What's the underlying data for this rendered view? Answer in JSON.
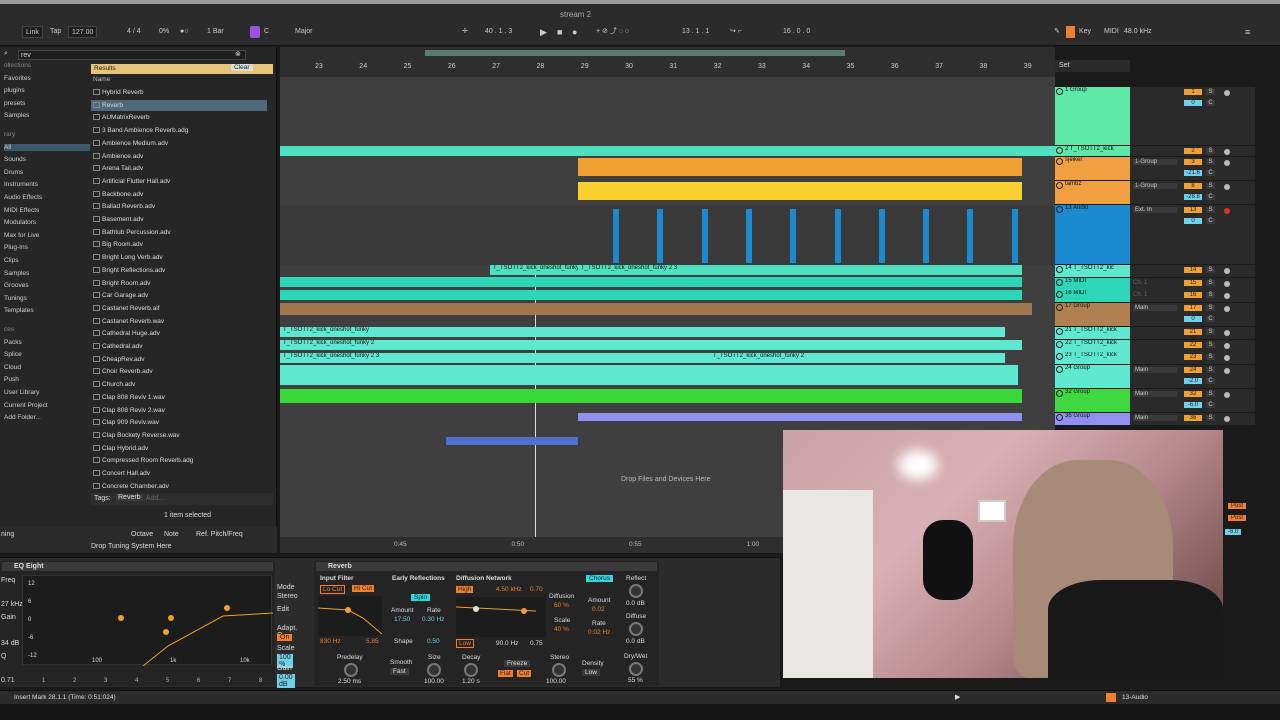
{
  "window_title": "stream 2",
  "transport": {
    "link": "Link",
    "tap": "Tap",
    "tempo": "127.00",
    "signature": "4 / 4",
    "cpu": "0%",
    "quantize": "1 Bar",
    "key_root": "C",
    "key_scale": "Major",
    "position": "40 . 1 . 3",
    "loop_start": "13 . 1 . 1",
    "loop_len": "16 . 0 . 0",
    "key_label": "Key",
    "midi_label": "MIDI",
    "sample_rate": "48.0 kHz"
  },
  "browser": {
    "search": "rev",
    "categories": [
      {
        "label": "ollections",
        "header": true
      },
      {
        "label": "Favorites"
      },
      {
        "label": "plugins"
      },
      {
        "label": "presets"
      },
      {
        "label": "Samples"
      },
      {
        "label": "rary",
        "header": true
      },
      {
        "label": "All"
      },
      {
        "label": "Sounds"
      },
      {
        "label": "Drums"
      },
      {
        "label": "Instruments"
      },
      {
        "label": "Audio Effects"
      },
      {
        "label": "MIDI Effects"
      },
      {
        "label": "Modulators"
      },
      {
        "label": "Max for Live"
      },
      {
        "label": "Plug-Ins"
      },
      {
        "label": "Clips"
      },
      {
        "label": "Samples"
      },
      {
        "label": "Grooves"
      },
      {
        "label": "Tunings"
      },
      {
        "label": "Templates"
      },
      {
        "label": "ces",
        "header": true
      },
      {
        "label": "Packs"
      },
      {
        "label": "Splice"
      },
      {
        "label": "Cloud"
      },
      {
        "label": "Push"
      },
      {
        "label": "User Library"
      },
      {
        "label": "Current Project"
      },
      {
        "label": "Add Folder..."
      }
    ],
    "results_label": "Results",
    "clear_label": "Clear",
    "name_header": "Name",
    "results": [
      "Hybrid Reverb",
      "Reverb",
      "AUMatrixReverb",
      "3 Band Ambience Reverb.adg",
      "Ambience Medium.adv",
      "Ambience.adv",
      "Arena Tail.adv",
      "Artificial Flutter Hall.adv",
      "Backbone.adv",
      "Ballad Reverb.adv",
      "Basement.adv",
      "Bathtub Percussion.adv",
      "Big Room.adv",
      "Bright Long Verb.adv",
      "Bright Reflections.adv",
      "Bright Room.adv",
      "Car Garage.adv",
      "Castanet Reverb.aif",
      "Castanet Reverb.wav",
      "Cathedral Huge.adv",
      "Cathedral.adv",
      "CheapRev.adv",
      "Choir Reverb.adv",
      "Church.adv",
      "Clap 808 Reviv 1.wav",
      "Clap 808 Reviv 2.wav",
      "Clap 909 Reviv.wav",
      "Clap Bockety Reverse.wav",
      "Clap Hybrid.adv",
      "Compressed Room Reverb.adg",
      "Concert Hall.adv",
      "Concrete Chamber.adv"
    ],
    "tags_label": "Tags:",
    "tag": "Reverb",
    "add_label": "Add...",
    "selected": "1 item selected",
    "tuning_octave": "Octave",
    "tuning_note": "Note",
    "tuning_ref": "Ref. Pitch/Freq",
    "tuning_label": "ning",
    "drop_tuning": "Drop Tuning System Here"
  },
  "ruler": [
    "23",
    "24",
    "25",
    "26",
    "27",
    "28",
    "29",
    "30",
    "31",
    "32",
    "33",
    "34",
    "35",
    "36",
    "37",
    "38",
    "39"
  ],
  "time_ruler": [
    "0:45",
    "0:50",
    "0:55",
    "1:00"
  ],
  "clips": {
    "c1": "T_TSOTT2_kick_oneshot_funky",
    "c2": "T_TSOTT2_kick_oneshot_funky 2 3",
    "c3": "T_TSOTT2_kick_oneshot_funky",
    "c4": "T_TSOTT2_kick_oneshot_funky 2",
    "c5": "T_TSOTT2_kick_oneshot_funky 2 3",
    "c6": "T_TSOTT2_kick_oneshot_funky 2"
  },
  "drop_files": "Drop Files and Devices Here",
  "set_label": "Set",
  "tracks": [
    {
      "name": "1 Group",
      "color": "#5ee8a8",
      "num": "1",
      "vol": "0"
    },
    {
      "name": "2 T_TSOTT2_kick",
      "color": "#5ee8a8",
      "num": "2",
      "vol": ""
    },
    {
      "name": "sjeiker",
      "color": "#f0a040",
      "num": "3",
      "vol": "-21.6",
      "route": "1-Group"
    },
    {
      "name": "tambz",
      "color": "#f0a040",
      "num": "8",
      "vol": "-28.8",
      "route": "1-Group"
    },
    {
      "name": "13 Audio",
      "color": "#1c8ad0",
      "num": "13",
      "vol": "0",
      "route": "Ext. In"
    },
    {
      "name": "14 T_TSOTT2_kic",
      "color": "#5ee8d0",
      "num": "14",
      "vol": ""
    },
    {
      "name": "15 MIDI",
      "color": "#2ed6b8",
      "num": "15",
      "vol": "Ch. 1"
    },
    {
      "name": "16 MIDI",
      "color": "#2ed6b8",
      "num": "16",
      "vol": "Ch. 1"
    },
    {
      "name": "17 Group",
      "color": "#b08050",
      "num": "17",
      "vol": "0",
      "route": "Main"
    },
    {
      "name": "21 T_TSOTT2_kick",
      "color": "#5ee8d0",
      "num": "21",
      "vol": ""
    },
    {
      "name": "22 T_TSOTT2_kick",
      "color": "#5ee8d0",
      "num": "22",
      "vol": ""
    },
    {
      "name": "23 T_TSOTT2_kick",
      "color": "#5ee8d0",
      "num": "23",
      "vol": ""
    },
    {
      "name": "24 Group",
      "color": "#5ee8d0",
      "num": "24",
      "vol": "-2.0",
      "route": "Main"
    },
    {
      "name": "32 Group",
      "color": "#40d840",
      "num": "32",
      "vol": "-6.0",
      "route": "Main"
    },
    {
      "name": "36 Group",
      "color": "#9090f0",
      "num": "36",
      "vol": "",
      "route": "Main"
    }
  ],
  "mixer": {
    "main": "Main",
    "ext_in": "Ext. In",
    "in": "In",
    "auto": "Auto",
    "off": "Off",
    "inf": "-∞"
  },
  "eq": {
    "title": "EQ Eight",
    "freq": "Freq",
    "gain": "Gain",
    "q": "Q",
    "mode": "Mode",
    "mode_val": "Stereo",
    "edit": "Edit",
    "adapt": "Adapt. Q",
    "adapt_val": "On",
    "scale": "Scale",
    "scale_val": "100 %",
    "gain_label": "Gain",
    "gain_val": "0.00 dB",
    "freq_val": "27 kHz",
    "gain_l": "34 dB",
    "q_val": "0.71",
    "y_labels": [
      "12",
      "6",
      "0",
      "-6",
      "-12"
    ],
    "x_labels": [
      "100",
      "1k",
      "10k"
    ],
    "bands": [
      "1",
      "2",
      "3",
      "4",
      "5",
      "6",
      "7",
      "8"
    ]
  },
  "reverb": {
    "title": "Reverb",
    "input_filter": "Input Filter",
    "lo_cut": "Lo Cut",
    "hi_cut": "Hi Cut",
    "lo_val": "830 Hz",
    "hi_val": "5.85",
    "early": "Early Reflections",
    "spin": "Spin",
    "amount": "Amount",
    "rate": "Rate",
    "amount_val": "17.50",
    "rate_val": "0.30 Hz",
    "shape": "Shape",
    "shape_val": "0.50",
    "diffusion_net": "Diffusion Network",
    "high": "High",
    "freq": "4.50 kHz",
    "ratio": "0.70",
    "diffusion": "Diffusion",
    "diff_val": "60 %",
    "scale": "Scale",
    "scale_val": "40 %",
    "low": "Low",
    "low_freq": "90.0 Hz",
    "low_ratio": "0.75",
    "chorus": "Chorus",
    "ch_amount": "Amount",
    "ch_amount_val": "0.02",
    "ch_rate": "Rate",
    "ch_rate_val": "0.02 Hz",
    "reflect": "Reflect",
    "reflect_val": "0.0 dB",
    "diffuse": "Diffuse",
    "diffuse_val": "0.0 dB",
    "predelay": "Predelay",
    "predelay_val": "2.50 ms",
    "smooth": "Smooth",
    "smooth_val": "Fast",
    "size": "Size",
    "size_val": "100.00",
    "decay": "Decay",
    "decay_val": "1.20 s",
    "freeze": "Freeze",
    "flat": "Flat",
    "cut": "Cut",
    "stereo": "Stereo",
    "stereo_val": "100.00",
    "density": "Density",
    "density_val": "Low",
    "drywet": "Dry/Wet",
    "drywet_val": "55 %"
  },
  "status": "Insert Mark 28.1.1 (Time: 0:51:024)",
  "status_right": "13-Audio",
  "mixer_right": {
    "post": "Post",
    "val": "-6.0"
  }
}
